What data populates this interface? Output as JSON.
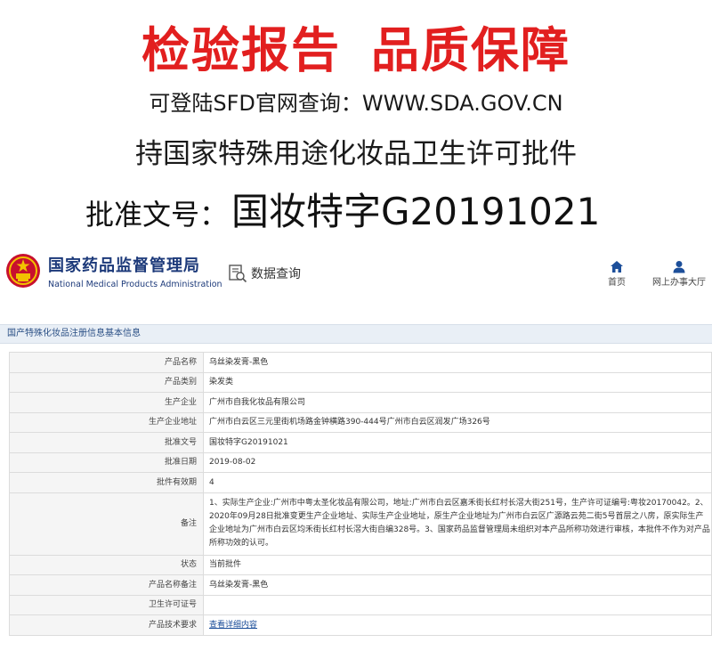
{
  "banner": {
    "title_left": "检验报告",
    "title_right": "品质保障",
    "query_line": "可登陆SFD官网查询：WWW.SDA.GOV.CN",
    "permit_line": "持国家特殊用途化妆品卫生许可批件",
    "approval_label": "批准文号：",
    "approval_number": "国妆特字G20191021"
  },
  "header": {
    "agency_cn": "国家药品监督管理局",
    "agency_en": "National Medical Products Administration",
    "data_query": "数据查询",
    "nav": [
      {
        "label": "首页",
        "icon": "home-icon"
      },
      {
        "label": "网上办事大厅",
        "icon": "user-icon"
      }
    ],
    "brand_color": "#1d3a7a"
  },
  "section": {
    "title": "国产特殊化妆品注册信息基本信息"
  },
  "rows": [
    {
      "label": "产品名称",
      "value": "乌丝染发膏-黑色"
    },
    {
      "label": "产品类别",
      "value": "染发类"
    },
    {
      "label": "生产企业",
      "value": "广州市自我化妆品有限公司"
    },
    {
      "label": "生产企业地址",
      "value": "广州市白云区三元里街机场路金钟横路390-444号广州市白云区润发广场326号"
    },
    {
      "label": "批准文号",
      "value": "国妆特字G20191021"
    },
    {
      "label": "批准日期",
      "value": "2019-08-02"
    },
    {
      "label": "批件有效期",
      "value": "4"
    },
    {
      "label": "备注",
      "value": "1、实际生产企业:广州市中粤太圣化妆品有限公司，地址:广州市白云区嘉禾街长红村长滘大街251号，生产许可证编号:粤妆20170042。2、2020年09月28日批准变更生产企业地址、实际生产企业地址，原生产企业地址为广州市白云区广源路云苑二街5号首层之八房，原实际生产企业地址为广州市白云区均禾街长红村长滘大街自编328号。3、国家药品监督管理局未组织对本产品所称功效进行审核，本批件不作为对产品所称功效的认可。"
    },
    {
      "label": "状态",
      "value": "当前批件"
    },
    {
      "label": "产品名称备注",
      "value": "乌丝染发膏-黑色"
    },
    {
      "label": "卫生许可证号",
      "value": ""
    },
    {
      "label": "产品技术要求",
      "value": "查看详细内容"
    }
  ],
  "colors": {
    "banner_red": "#e21f1f",
    "link_blue": "#1d4f9a",
    "section_bar": "#e9eff6"
  }
}
